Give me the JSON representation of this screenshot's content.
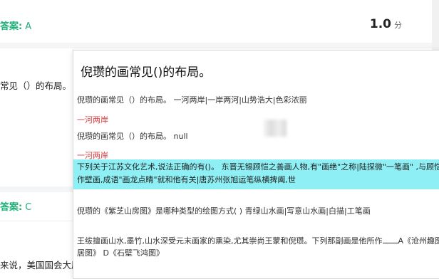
{
  "background": {
    "answer1": {
      "label": "答案:",
      "value": "A"
    },
    "score": {
      "value": "1.0",
      "unit": "分"
    },
    "question_fragment": "常见（）的布局。",
    "answer2": {
      "label": "答案:",
      "value": "C"
    },
    "bottom_fragment": "来说，美国国会大厦"
  },
  "popup": {
    "title": "倪瓒的画常见()的布局。",
    "rows": [
      {
        "text": "倪瓒的画常见（）的布局。 一河两岸|一岸两河|山势浩大|色彩浓丽",
        "style": "normal"
      },
      {
        "text": "一河两岸",
        "style": "red"
      },
      {
        "text": "倪瓒的画常见（）的布局。 null",
        "style": "normal"
      },
      {
        "text": "一河两岸",
        "style": "red"
      }
    ],
    "highlight": {
      "line1": "下列关于江苏文化艺术,说法正确的有()。 东晋无锡顾恺之善画人物,有\"画绝\"之称|陆探微\"一笔画\" ,与顾恺",
      "line2": "作壁画,成语\"画龙点睛\"就和他有关|唐苏州张旭运笔纵横捭阖,世"
    },
    "row_zishan": "倪瓒的《紫芝山房图》是哪种类型的绘图方式( ) 青绿山水画|写意山水画|白描|工笔画",
    "row_wang_line1": "王绂擅画山水,墨竹,山水深受元末画家的熏染,尤其崇尚王蒙和倪瓒。下列那副画是他所作",
    "row_wang_line1_tail": "A《沧州趣图",
    "row_wang_line2": "居图》 D《石壁飞鸿图》"
  },
  "colors": {
    "accent_green": "#21b07a",
    "answer_red": "#e03c3c",
    "highlight_cyan": "#8ef0f5"
  }
}
